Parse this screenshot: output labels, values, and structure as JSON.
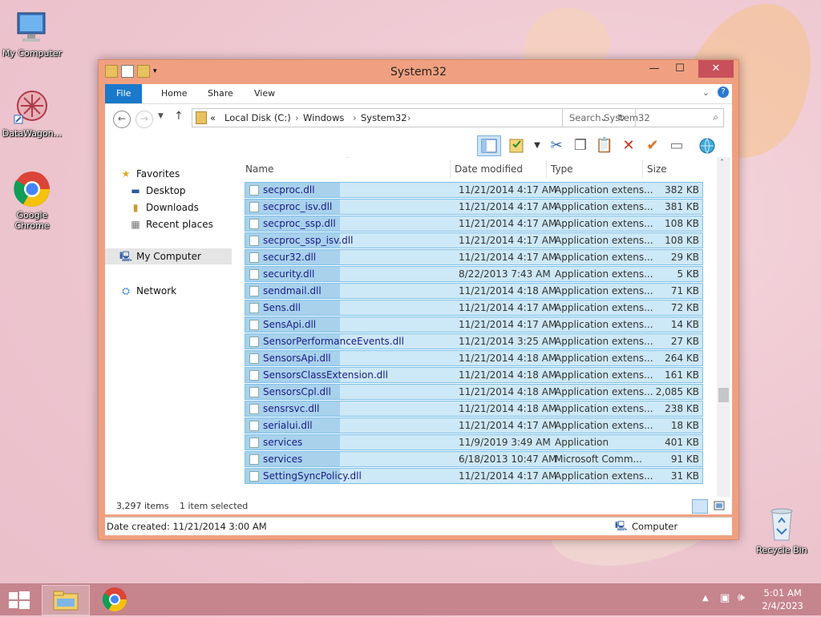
{
  "desktop": {
    "icons": [
      {
        "label": "My Computer"
      },
      {
        "label": "DataWagon..."
      },
      {
        "label": "Google Chrome"
      },
      {
        "label": "Recycle Bin"
      }
    ]
  },
  "window": {
    "title": "System32",
    "ribbon_tabs": [
      "File",
      "Home",
      "Share",
      "View"
    ],
    "breadcrumb": [
      "«",
      "Local Disk (C:)",
      "Windows",
      "System32"
    ],
    "search_placeholder": "Search System32",
    "nav": {
      "favorites": "Favorites",
      "desktop": "Desktop",
      "downloads": "Downloads",
      "recent": "Recent places",
      "computer": "My Computer",
      "network": "Network"
    },
    "columns": [
      "Name",
      "Date modified",
      "Type",
      "Size"
    ],
    "files": [
      {
        "name": "secproc.dll",
        "date": "11/21/2014 4:17 AM",
        "type": "Application extens...",
        "size": "382 KB"
      },
      {
        "name": "secproc_isv.dll",
        "date": "11/21/2014 4:17 AM",
        "type": "Application extens...",
        "size": "381 KB"
      },
      {
        "name": "secproc_ssp.dll",
        "date": "11/21/2014 4:17 AM",
        "type": "Application extens...",
        "size": "108 KB"
      },
      {
        "name": "secproc_ssp_isv.dll",
        "date": "11/21/2014 4:17 AM",
        "type": "Application extens...",
        "size": "108 KB"
      },
      {
        "name": "secur32.dll",
        "date": "11/21/2014 4:17 AM",
        "type": "Application extens...",
        "size": "29 KB"
      },
      {
        "name": "security.dll",
        "date": "8/22/2013 7:43 AM",
        "type": "Application extens...",
        "size": "5 KB"
      },
      {
        "name": "sendmail.dll",
        "date": "11/21/2014 4:18 AM",
        "type": "Application extens...",
        "size": "71 KB"
      },
      {
        "name": "Sens.dll",
        "date": "11/21/2014 4:17 AM",
        "type": "Application extens...",
        "size": "72 KB"
      },
      {
        "name": "SensApi.dll",
        "date": "11/21/2014 4:17 AM",
        "type": "Application extens...",
        "size": "14 KB"
      },
      {
        "name": "SensorPerformanceEvents.dll",
        "date": "11/21/2014 3:25 AM",
        "type": "Application extens...",
        "size": "27 KB"
      },
      {
        "name": "SensorsApi.dll",
        "date": "11/21/2014 4:18 AM",
        "type": "Application extens...",
        "size": "264 KB"
      },
      {
        "name": "SensorsClassExtension.dll",
        "date": "11/21/2014 4:18 AM",
        "type": "Application extens...",
        "size": "161 KB"
      },
      {
        "name": "SensorsCpl.dll",
        "date": "11/21/2014 4:18 AM",
        "type": "Application extens...",
        "size": "2,085 KB"
      },
      {
        "name": "sensrsvc.dll",
        "date": "11/21/2014 4:18 AM",
        "type": "Application extens...",
        "size": "238 KB"
      },
      {
        "name": "serialui.dll",
        "date": "11/21/2014 4:17 AM",
        "type": "Application extens...",
        "size": "18 KB"
      },
      {
        "name": "services",
        "date": "11/9/2019 3:49 AM",
        "type": "Application",
        "size": "401 KB"
      },
      {
        "name": "services",
        "date": "6/18/2013 10:47 AM",
        "type": "Microsoft Comm...",
        "size": "91 KB"
      },
      {
        "name": "SettingSyncPolicy.dll",
        "date": "11/21/2014 4:17 AM",
        "type": "Application extens...",
        "size": "31 KB"
      }
    ],
    "status": {
      "items": "3,297 items",
      "selected": "1 item selected"
    },
    "details": {
      "created": "Date created: 11/21/2014 3:00 AM",
      "location": "Computer"
    }
  },
  "taskbar": {
    "time": "5:01 AM",
    "date": "2/4/2023"
  },
  "colors": {
    "titlebar": "#f0a080",
    "file_tab": "#1979ca",
    "selection": "#cde8f6",
    "taskbar": "#c6848d"
  }
}
